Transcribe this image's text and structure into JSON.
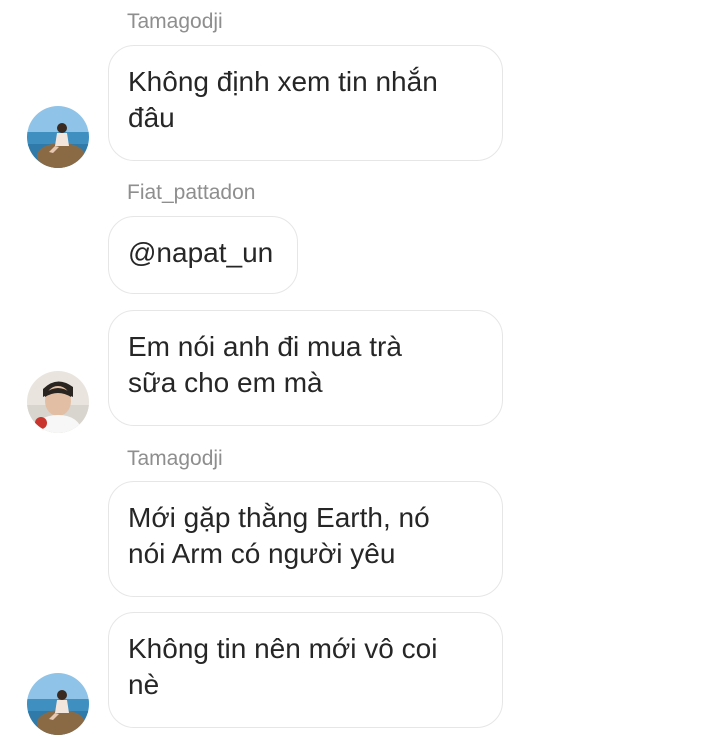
{
  "messages": [
    {
      "sender": "Tamagodji",
      "line1": "Không định xem tin nhắn",
      "line2": "đâu",
      "avatar": "beach-avatar-icon"
    },
    {
      "sender": "Fiat_pattadon",
      "text": "@napat_un"
    },
    {
      "line1": "Em nói anh đi mua trà",
      "line2": "sữa cho em mà",
      "avatar": "portrait-avatar-icon"
    },
    {
      "sender": "Tamagodji",
      "line1": "Mới gặp thằng Earth, nó",
      "line2": "nói Arm có người yêu"
    },
    {
      "line1": "Không tin nên mới vô coi",
      "line2": "nè",
      "avatar": "beach-avatar-icon"
    }
  ],
  "colors": {
    "sender_name": "#8e8e8e",
    "bubble_border": "#e6e6e6",
    "message_text": "#262626"
  }
}
